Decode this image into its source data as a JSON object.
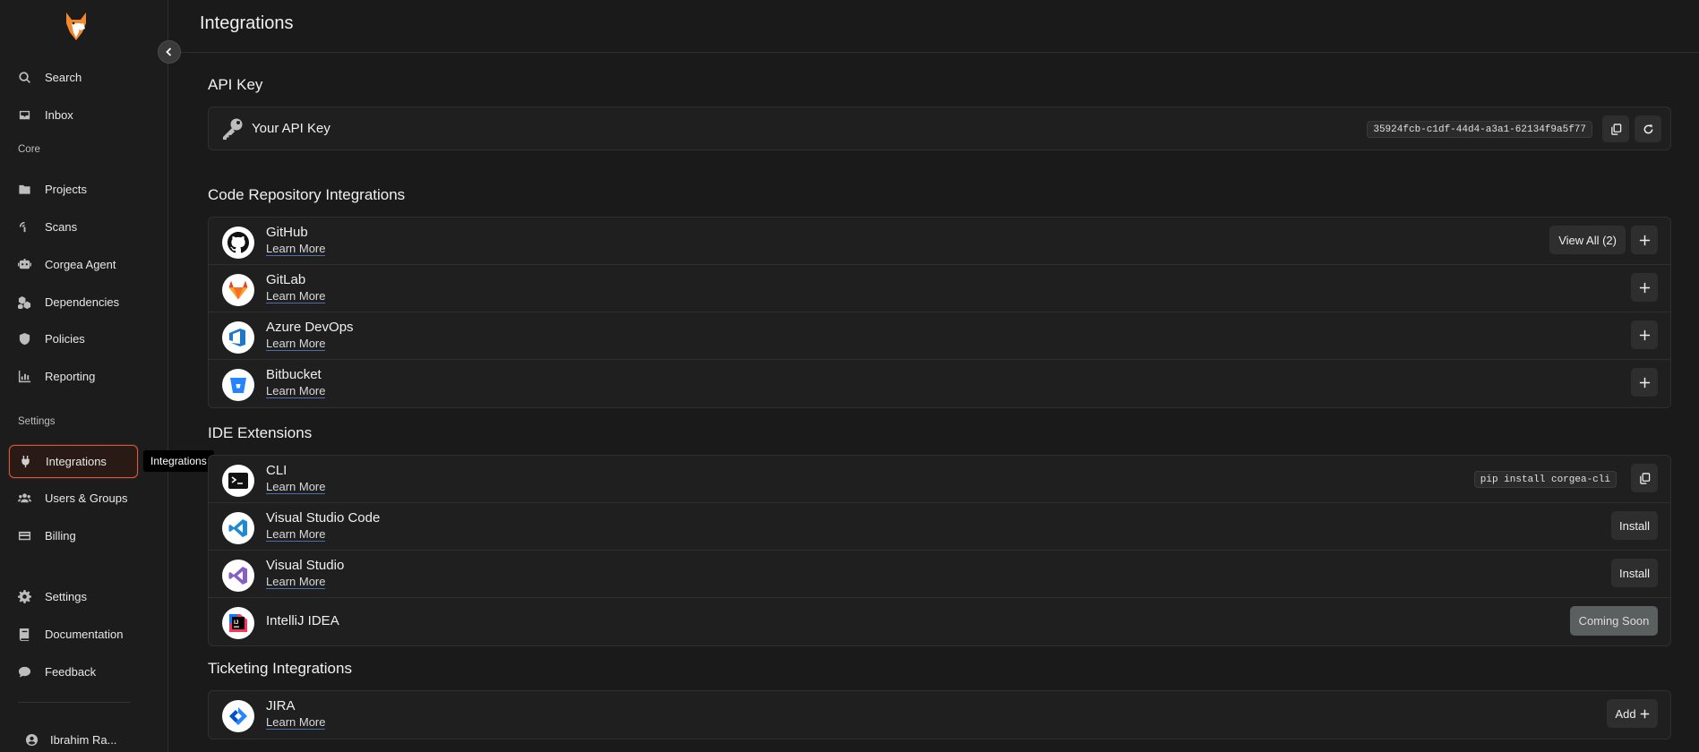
{
  "page": {
    "title": "Integrations"
  },
  "sidebar": {
    "top_items": [
      {
        "label": "Search",
        "icon": "search-icon"
      },
      {
        "label": "Inbox",
        "icon": "inbox-icon"
      }
    ],
    "sections": {
      "core": "Core",
      "settings": "Settings"
    },
    "core_items": [
      {
        "label": "Projects",
        "icon": "folder-icon"
      },
      {
        "label": "Scans",
        "icon": "scan-icon"
      },
      {
        "label": "Corgea Agent",
        "icon": "robot-icon"
      },
      {
        "label": "Dependencies",
        "icon": "dependencies-icon"
      },
      {
        "label": "Policies",
        "icon": "shield-icon"
      },
      {
        "label": "Reporting",
        "icon": "chart-icon"
      }
    ],
    "settings_items": [
      {
        "label": "Integrations",
        "icon": "plug-icon",
        "active": true
      },
      {
        "label": "Users & Groups",
        "icon": "users-icon"
      },
      {
        "label": "Billing",
        "icon": "credit-card-icon"
      }
    ],
    "bottom_items": [
      {
        "label": "Settings",
        "icon": "gear-icon"
      },
      {
        "label": "Documentation",
        "icon": "book-icon"
      },
      {
        "label": "Feedback",
        "icon": "chat-icon"
      }
    ],
    "user": {
      "name": "Ibrahim Ra...",
      "icon": "user-icon"
    },
    "tooltip": "Integrations"
  },
  "api_key": {
    "section_title": "API Key",
    "label": "Your API Key",
    "value": "35924fcb-c1df-44d4-a3a1-62134f9a5f77",
    "icon": "key-icon"
  },
  "code_repos": {
    "section_title": "Code Repository Integrations",
    "items": [
      {
        "name": "GitHub",
        "learn": "Learn More",
        "view_all": "View All (2)",
        "icon": "github-icon"
      },
      {
        "name": "GitLab",
        "learn": "Learn More",
        "icon": "gitlab-icon"
      },
      {
        "name": "Azure DevOps",
        "learn": "Learn More",
        "icon": "azure-devops-icon"
      },
      {
        "name": "Bitbucket",
        "learn": "Learn More",
        "icon": "bitbucket-icon"
      }
    ]
  },
  "ide": {
    "section_title": "IDE Extensions",
    "items": [
      {
        "name": "CLI",
        "learn": "Learn More",
        "command": "pip install corgea-cli",
        "icon": "terminal-icon"
      },
      {
        "name": "Visual Studio Code",
        "learn": "Learn More",
        "action": "Install",
        "icon": "vscode-icon"
      },
      {
        "name": "Visual Studio",
        "learn": "Learn More",
        "action": "Install",
        "icon": "visual-studio-icon"
      },
      {
        "name": "IntelliJ IDEA",
        "action": "Coming Soon",
        "icon": "intellij-icon"
      }
    ]
  },
  "ticketing": {
    "section_title": "Ticketing Integrations",
    "items": [
      {
        "name": "JIRA",
        "learn": "Learn More",
        "action": "Add",
        "icon": "jira-icon"
      }
    ]
  },
  "colors": {
    "background": "#1a1a1a",
    "active_border": "#d9573a",
    "card": "#1f1f1f"
  }
}
